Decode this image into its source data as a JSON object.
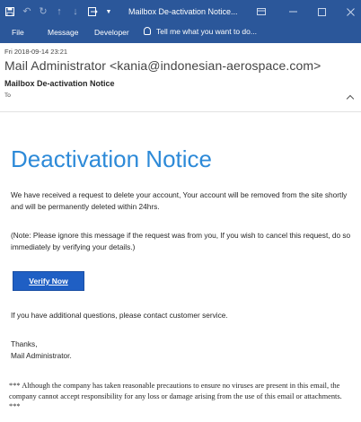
{
  "title_bar": {
    "title": "Mailbox De-activation Notice...",
    "icons": [
      "save-icon",
      "undo-icon",
      "redo-icon",
      "up-arrow-icon",
      "down-arrow-icon",
      "forward-icon",
      "customize-icon"
    ],
    "window_controls": [
      "ribbon-display-icon",
      "minimize-icon",
      "maximize-icon",
      "close-icon"
    ]
  },
  "ribbon": {
    "tabs": [
      {
        "label": "File"
      },
      {
        "label": "Message"
      },
      {
        "label": "Developer"
      }
    ],
    "tell_me": "Tell me what you want to do..."
  },
  "header": {
    "date": "Fri 2018-09-14 23:21",
    "from": "Mail Administrator <kania@indonesian-aerospace.com>",
    "subject": "Mailbox De-activation Notice",
    "to_label": "To"
  },
  "body": {
    "title": "Deactivation Notice",
    "paragraph1": "We have received a request to delete your account, Your account will be removed from the site shortly and will be permanently deleted within 24hrs.",
    "paragraph2": "(Note: Please ignore this message if the request was from you, If you wish to cancel this request, do so immediately by verifying your details.)",
    "button_label": "Verify Now",
    "paragraph3": "If you have additional questions, please contact customer service.",
    "signoff": "Thanks,",
    "signature": "Mail Administrator.",
    "disclaimer": "*** Although the company has taken reasonable precautions to ensure no viruses are present in this email, the company cannot accept responsibility for any loss or damage arising from the use of this email or attachments. ***"
  },
  "colors": {
    "accent": "#2b579a",
    "title_blue": "#2d8ad8",
    "button_blue": "#1f5fc4"
  }
}
